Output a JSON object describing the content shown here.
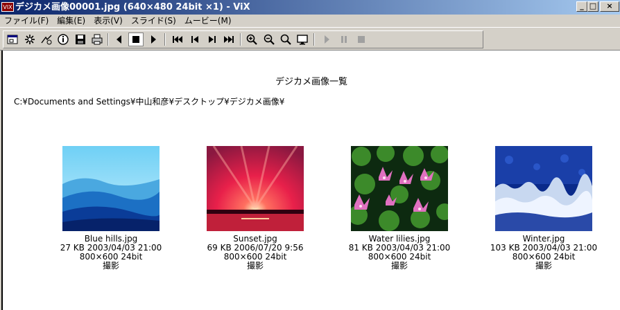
{
  "window": {
    "app_icon": "VIX",
    "title": "デジカメ画像00001.jpg (640×480 24bit ×1) - ViX",
    "min_label": "_",
    "max_label": "□",
    "close_label": "×"
  },
  "menu": [
    {
      "label": "ファイル(F)"
    },
    {
      "label": "編集(E)"
    },
    {
      "label": "表示(V)"
    },
    {
      "label": "スライド(S)"
    },
    {
      "label": "ムービー(M)"
    }
  ],
  "toolbar": {
    "icons": [
      "window-icon",
      "sparkle-icon",
      "effects-icon",
      "info-icon",
      "save-icon",
      "print-icon",
      "prev-icon",
      "stop-icon",
      "next-icon",
      "first-icon",
      "prev-page-icon",
      "next-page-icon",
      "last-icon",
      "zoom-in-icon",
      "zoom-out-icon",
      "zoom-fit-icon",
      "fullscreen-icon",
      "play-icon",
      "pause-icon",
      "stop-slide-icon"
    ]
  },
  "content": {
    "page_title": "デジカメ画像一覧",
    "path": "C:¥Documents and Settings¥中山和彦¥デスクトップ¥デジカメ画像¥"
  },
  "thumbnails": [
    {
      "name": "Blue hills.jpg",
      "info": "27 KB 2003/04/03 21:00",
      "dims": "800×600  24bit",
      "note": "撮影"
    },
    {
      "name": "Sunset.jpg",
      "info": "69 KB 2006/07/20 9:56",
      "dims": "800×600  24bit",
      "note": "撮影"
    },
    {
      "name": "Water lilies.jpg",
      "info": "81 KB 2003/04/03 21:00",
      "dims": "800×600  24bit",
      "note": "撮影"
    },
    {
      "name": "Winter.jpg",
      "info": "103 KB 2003/04/03 21:00",
      "dims": "800×600  24bit",
      "note": "撮影"
    }
  ]
}
